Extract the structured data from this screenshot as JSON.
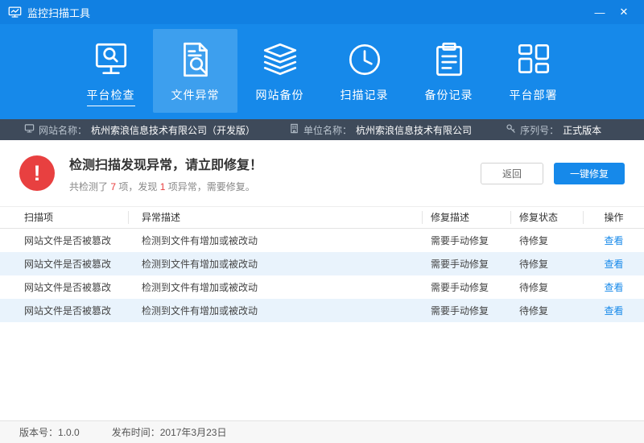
{
  "window": {
    "title": "监控扫描工具",
    "minimize_glyph": "—",
    "close_glyph": "✕"
  },
  "toolbar": {
    "items": [
      {
        "label": "平台检查"
      },
      {
        "label": "文件异常"
      },
      {
        "label": "网站备份"
      },
      {
        "label": "扫描记录"
      },
      {
        "label": "备份记录"
      },
      {
        "label": "平台部署"
      }
    ]
  },
  "infobar": {
    "site_label": "网站名称：",
    "site_value": "杭州索浪信息技术有限公司（开发版）",
    "org_label": "单位名称：",
    "org_value": "杭州索浪信息技术有限公司",
    "serial_label": "序列号：",
    "serial_value": "正式版本"
  },
  "alert": {
    "icon_glyph": "!",
    "title": "检测扫描发现异常，请立即修复！",
    "summary_prefix": "共检测了 ",
    "detected_count": "7",
    "summary_middle": " 项，发现 ",
    "abnormal_count": "1",
    "summary_suffix": " 项异常，需要修复。",
    "back_button": "返回",
    "fix_button": "一键修复"
  },
  "table": {
    "headers": {
      "item": "扫描项",
      "desc": "异常描述",
      "fix": "修复描述",
      "status": "修复状态",
      "action": "操作"
    },
    "rows": [
      {
        "item": "网站文件是否被篡改",
        "desc": "检测到文件有增加或被改动",
        "fix": "需要手动修复",
        "status": "待修复",
        "action": "查看"
      },
      {
        "item": "网站文件是否被篡改",
        "desc": "检测到文件有增加或被改动",
        "fix": "需要手动修复",
        "status": "待修复",
        "action": "查看"
      },
      {
        "item": "网站文件是否被篡改",
        "desc": "检测到文件有增加或被改动",
        "fix": "需要手动修复",
        "status": "待修复",
        "action": "查看"
      },
      {
        "item": "网站文件是否被篡改",
        "desc": "检测到文件有增加或被改动",
        "fix": "需要手动修复",
        "status": "待修复",
        "action": "查看"
      }
    ]
  },
  "footer": {
    "version_label": "版本号：",
    "version_value": "1.0.0",
    "date_label": "发布时间：",
    "date_value": "2017年3月23日"
  },
  "colors": {
    "accent_blue": "#1689ea",
    "alert_red": "#e84040",
    "infobar_bg": "#3e4a5a",
    "row_alt": "#e9f3fc"
  }
}
